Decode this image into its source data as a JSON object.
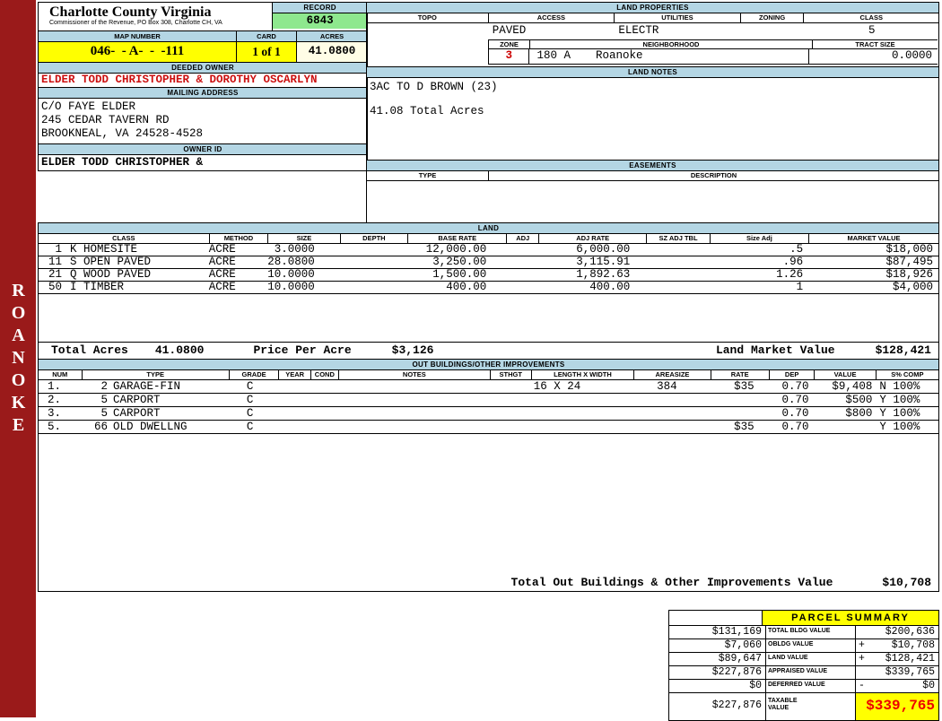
{
  "sidebar": {
    "district": "ROANOKE"
  },
  "colors": {
    "header_blue": "#b4d6e4",
    "record_green": "#8ee88e",
    "highlight_yellow": "#ffff00",
    "acres_cream": "#fffde6",
    "sidebar_red": "#9a1a1a",
    "owner_red": "#cc1111",
    "summary_red": "#ee0000"
  },
  "header": {
    "county": "Charlotte County Virginia",
    "subtitle": "Commissioner of the Revenue, PO Box 308, Charlotte CH, VA",
    "record_label": "RECORD",
    "record_value": "6843",
    "map_number_label": "MAP NUMBER",
    "map_number": "046-  - A-  -  -111",
    "card_label": "CARD",
    "card_value": "1 of 1",
    "acres_label": "ACRES",
    "acres_value": "41.0800",
    "deeded_owner_label": "DEEDED OWNER",
    "deeded_owner": "ELDER TODD CHRISTOPHER & DOROTHY OSCARLYN",
    "mailing_address_label": "MAILING ADDRESS",
    "mailing_address": [
      "C/O FAYE ELDER",
      "245 CEDAR TAVERN RD",
      "BROOKNEAL, VA 24528-4528"
    ],
    "owner_id_label": "OWNER ID",
    "owner_id": "ELDER TODD CHRISTOPHER &"
  },
  "land_properties": {
    "title": "LAND PROPERTIES",
    "col_topo": "TOPO",
    "col_access": "ACCESS",
    "col_utilities": "UTILITIES",
    "col_zoning": "ZONING",
    "col_class": "CLASS",
    "topo": "",
    "access": "PAVED",
    "utilities": "ELECTR",
    "zoning": "",
    "class": "5",
    "zone_label": "ZONE",
    "zone": "3",
    "neighborhood_label": "NEIGHBORHOOD",
    "neighborhood_code": "180 A",
    "neighborhood": "Roanoke",
    "tract_size_label": "TRACT SIZE",
    "tract_size": "0.0000"
  },
  "land_notes": {
    "title": "LAND NOTES",
    "lines": [
      "3AC TO D BROWN (23)",
      "41.08 Total Acres"
    ]
  },
  "easements": {
    "title": "EASEMENTS",
    "col_type": "TYPE",
    "col_description": "DESCRIPTION"
  },
  "land": {
    "title": "LAND",
    "columns": [
      "CLASS",
      "METHOD",
      "SIZE",
      "DEPTH",
      "BASE RATE",
      "ADJ",
      "ADJ RATE",
      "SZ ADJ TBL",
      "Size Adj",
      "MARKET VALUE"
    ],
    "rows": [
      {
        "num": "1",
        "cls": "K HOMESITE",
        "method": "ACRE",
        "size": "3.0000",
        "depth": "",
        "base_rate": "12,000.00",
        "adj": "",
        "adj_rate": "6,000.00",
        "sz_adj_tbl": "",
        "size_adj": ".5",
        "market_value": "$18,000"
      },
      {
        "num": "11",
        "cls": "S OPEN PAVED",
        "method": "ACRE",
        "size": "28.0800",
        "depth": "",
        "base_rate": "3,250.00",
        "adj": "",
        "adj_rate": "3,115.91",
        "sz_adj_tbl": "",
        "size_adj": ".96",
        "market_value": "$87,495"
      },
      {
        "num": "21",
        "cls": "Q WOOD PAVED",
        "method": "ACRE",
        "size": "10.0000",
        "depth": "",
        "base_rate": "1,500.00",
        "adj": "",
        "adj_rate": "1,892.63",
        "sz_adj_tbl": "",
        "size_adj": "1.26",
        "market_value": "$18,926"
      },
      {
        "num": "50",
        "cls": "I TIMBER",
        "method": "ACRE",
        "size": "10.0000",
        "depth": "",
        "base_rate": "400.00",
        "adj": "",
        "adj_rate": "400.00",
        "sz_adj_tbl": "",
        "size_adj": "1",
        "market_value": "$4,000"
      }
    ],
    "total_acres_label": "Total Acres",
    "total_acres": "41.0800",
    "price_per_acre_label": "Price Per Acre",
    "price_per_acre": "$3,126",
    "land_market_value_label": "Land Market Value",
    "land_market_value": "$128,421"
  },
  "out_buildings": {
    "title": "OUT BUILDINGS/OTHER IMPROVEMENTS",
    "columns": [
      "NUM",
      "TYPE",
      "GRADE",
      "YEAR",
      "COND",
      "NOTES",
      "STHGT",
      "LENGTH X WIDTH",
      "AREASIZE",
      "RATE",
      "DEP",
      "VALUE",
      "S% COMP"
    ],
    "rows": [
      {
        "num": "1.",
        "code": "2",
        "type": "GARAGE-FIN",
        "grade": "C",
        "year": "",
        "cond": "",
        "notes": "",
        "sthgt": "",
        "lxw": "16 X 24",
        "area": "384",
        "rate": "$35",
        "dep": "0.70",
        "value": "$9,408",
        "scomp": "N 100%"
      },
      {
        "num": "2.",
        "code": "5",
        "type": "CARPORT",
        "grade": "C",
        "year": "",
        "cond": "",
        "notes": "",
        "sthgt": "",
        "lxw": "",
        "area": "",
        "rate": "",
        "dep": "0.70",
        "value": "$500",
        "scomp": "Y 100%"
      },
      {
        "num": "3.",
        "code": "5",
        "type": "CARPORT",
        "grade": "C",
        "year": "",
        "cond": "",
        "notes": "",
        "sthgt": "",
        "lxw": "",
        "area": "",
        "rate": "",
        "dep": "0.70",
        "value": "$800",
        "scomp": "Y 100%"
      },
      {
        "num": "5.",
        "code": "66",
        "type": "OLD DWELLNG",
        "grade": "C",
        "year": "",
        "cond": "",
        "notes": "",
        "sthgt": "",
        "lxw": "",
        "area": "",
        "rate": "$35",
        "dep": "0.70",
        "value": "",
        "scomp": "Y 100%"
      }
    ],
    "total_label": "Total Out Buildings & Other Improvements Value",
    "total_value": "$10,708"
  },
  "parcel_summary": {
    "title": "PARCEL SUMMARY",
    "rows": [
      {
        "prior": "$131,169",
        "label": "TOTAL BLDG VALUE",
        "sign": "",
        "value": "$200,636"
      },
      {
        "prior": "$7,060",
        "label": "OBLDG VALUE",
        "sign": "+",
        "value": "$10,708"
      },
      {
        "prior": "$89,647",
        "label": "LAND VALUE",
        "sign": "+",
        "value": "$128,421"
      },
      {
        "prior": "$227,876",
        "label": "APPRAISED VALUE",
        "sign": "",
        "value": "$339,765"
      },
      {
        "prior": "$0",
        "label": "DEFERRED VALUE",
        "sign": "-",
        "value": "$0"
      }
    ],
    "taxable": {
      "prior": "$227,876",
      "label_line1": "TAXABLE",
      "label_line2": "VALUE",
      "value": "$339,765"
    }
  }
}
